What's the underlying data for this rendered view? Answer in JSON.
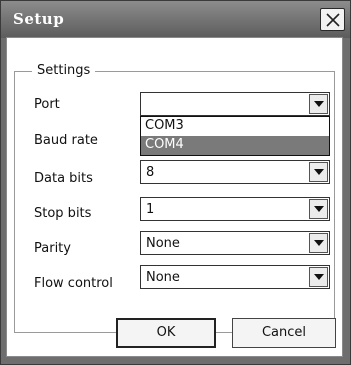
{
  "window": {
    "title": "Setup"
  },
  "group": {
    "label": "Settings"
  },
  "fields": {
    "port": {
      "label": "Port",
      "value": ""
    },
    "baud_rate": {
      "label": "Baud rate",
      "value": ""
    },
    "data_bits": {
      "label": "Data bits",
      "value": "8"
    },
    "stop_bits": {
      "label": "Stop bits",
      "value": "1"
    },
    "parity": {
      "label": "Parity",
      "value": "None"
    },
    "flow_control": {
      "label": "Flow control",
      "value": "None"
    }
  },
  "port_dropdown": {
    "options": [
      "COM3",
      "COM4"
    ],
    "highlighted": "COM4"
  },
  "buttons": {
    "ok": "OK",
    "cancel": "Cancel"
  },
  "colors": {
    "titlebar": "#6e6e6e",
    "dropdown_highlight": "#7a7a7a"
  }
}
